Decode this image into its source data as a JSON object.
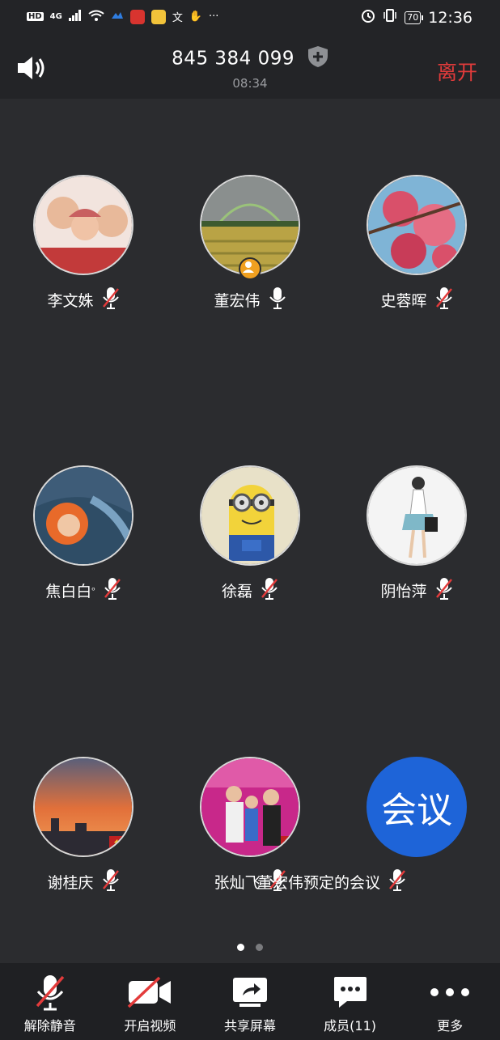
{
  "status_bar": {
    "hd": "HD",
    "net": "4G",
    "time": "12:36",
    "battery": "70"
  },
  "header": {
    "meeting_id": "845 384 099",
    "elapsed": "08:34",
    "leave": "离开"
  },
  "participants": [
    {
      "name": "李文姝",
      "mic": "muted",
      "avatar_color": "#c23a3a"
    },
    {
      "name": "董宏伟",
      "mic": "on",
      "avatar_color": "#b9a345",
      "host": true
    },
    {
      "name": "史蓉晖",
      "mic": "muted",
      "avatar_color": "#d9506a"
    },
    {
      "name": "焦白白",
      "suffix": "ₒ",
      "mic": "muted",
      "avatar_color": "#4a6a86"
    },
    {
      "name": "徐磊",
      "mic": "muted",
      "avatar_color": "#f2d33a"
    },
    {
      "name": "阴怡萍",
      "mic": "muted",
      "avatar_color": "#f4f4f4"
    },
    {
      "name": "谢桂庆",
      "mic": "muted",
      "avatar_color": "#e2703a"
    },
    {
      "name": "张灿飞",
      "mic": "muted",
      "avatar_color": "#c8288a"
    },
    {
      "name": "董宏伟预定的会议",
      "mic": "muted",
      "avatar_text": "会议",
      "avatar_color": "#1e64d8"
    }
  ],
  "pager": {
    "pages": 2,
    "active": 0
  },
  "toolbar": {
    "unmute": "解除静音",
    "video": "开启视频",
    "share": "共享屏幕",
    "members": "成员(11)",
    "more": "更多"
  },
  "colors": {
    "accent_leave": "#e23b3b",
    "muted_red": "#e33b3b",
    "logo_blue": "#1e64d8"
  }
}
